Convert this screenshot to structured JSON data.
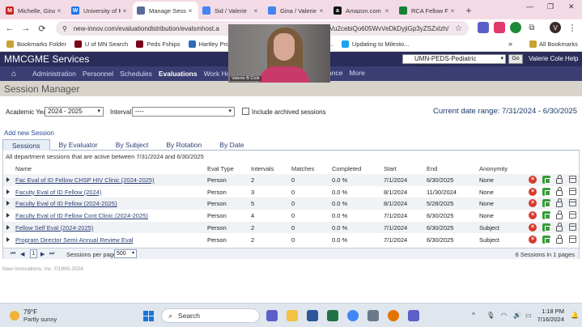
{
  "browser": {
    "tabs": [
      {
        "label": "Michelle, Gina",
        "favicon_color": "#c5221f",
        "favicon_glyph": "M",
        "active": false
      },
      {
        "label": "University of M",
        "favicon_color": "#1a73e8",
        "favicon_glyph": "W",
        "active": false
      },
      {
        "label": "Manage Session",
        "favicon_color": "#5a6a9a",
        "favicon_glyph": "",
        "active": true
      },
      {
        "label": "Sid / Valerie",
        "favicon_color": "#4285f4",
        "favicon_glyph": "",
        "active": false
      },
      {
        "label": "Gina / Valerie",
        "favicon_color": "#4285f4",
        "favicon_glyph": "",
        "active": false
      },
      {
        "label": "Amazon.com",
        "favicon_color": "#111111",
        "favicon_glyph": "a",
        "active": false
      },
      {
        "label": "RCA Fellow F",
        "favicon_color": "#188038",
        "favicon_glyph": "",
        "active": false
      }
    ],
    "tab_close": "×",
    "new_tab": "+",
    "window_controls": {
      "minimize": "—",
      "maximize": "❐",
      "close": "✕",
      "tab_search": "⌄"
    },
    "nav": {
      "back": "←",
      "forward": "→",
      "reload": "⟳"
    },
    "url_left": "new-innov.com/evaluationdistribution/evalsmhost.aspx",
    "url_right": "Vu2cebiQo605WvVeDkDyjiGp3yZSZxlzh/",
    "star": "☆",
    "profile_initial": "V",
    "menu": "⋮",
    "bookmarks": [
      {
        "label": "Bookmarks Folder",
        "icon": "folder-icon",
        "color": "#c9a233"
      },
      {
        "label": "U of MN Search",
        "icon": "gopher-m-icon",
        "color": "#7a0019"
      },
      {
        "label": "Peds Fships",
        "icon": "gopher-m-icon",
        "color": "#7a0019"
      },
      {
        "label": "Hartley Properties I...",
        "icon": "hartley-icon",
        "color": "#2f6db5"
      },
      {
        "label": "port Resou...",
        "icon": "page-icon",
        "color": "#555555"
      },
      {
        "label": "Updating to Milesto...",
        "icon": "twitter-icon",
        "color": "#1da1f2"
      }
    ],
    "bookmarks_more": "»",
    "all_bookmarks": "All Bookmarks"
  },
  "app": {
    "brand": "MMCGME Services",
    "department": "UMN-PEDS-Pediatric Infectious",
    "go_label": "Go",
    "user": "Valerie Cole",
    "help": "Help",
    "nav_left": [
      "Administration",
      "Personnel",
      "Schedules",
      "Evaluations",
      "Work Hours",
      "Lo"
    ],
    "nav_right": [
      "ance",
      "More"
    ],
    "active_nav": "Evaluations",
    "home_icon": "⌂"
  },
  "page": {
    "title": "Session Manager",
    "filters": {
      "academic_year_label": "Academic Year:",
      "academic_year_value": "2024 - 2025",
      "interval_label": "Interval:",
      "interval_value": "----",
      "archived_label": "Include archived sessions",
      "archived_checked": false,
      "caret": "▾"
    },
    "date_range": "Current date range: 7/31/2024 - 6/30/2025",
    "add_new": "Add new Session",
    "subtabs": [
      "Sessions",
      "By Evaluator",
      "By Subject",
      "By Rotation",
      "By Date"
    ],
    "active_subtab": "Sessions",
    "info_text": "All department sessions that are active between 7/31/2024 and 6/30/2025",
    "columns": [
      "Name",
      "Eval Type",
      "Intervals",
      "Matches",
      "Completed",
      "Start",
      "End",
      "Anonymity"
    ],
    "rows": [
      {
        "name": "Fac Eval of ID Fellow CHSP HIV Clinic (2024-2025)",
        "type": "Person",
        "intervals": "2",
        "matches": "0",
        "completed": "0.0 %",
        "start": "7/1/2024",
        "end": "6/30/2025",
        "anonymity": "None"
      },
      {
        "name": "Faculty Eval of ID Fellow (2024)",
        "type": "Person",
        "intervals": "3",
        "matches": "0",
        "completed": "0.0 %",
        "start": "8/1/2024",
        "end": "11/30/2024",
        "anonymity": "None"
      },
      {
        "name": "Faculty Eval of ID Fellow (2024-2025)",
        "type": "Person",
        "intervals": "5",
        "matches": "0",
        "completed": "0.0 %",
        "start": "8/1/2024",
        "end": "5/28/2025",
        "anonymity": "None"
      },
      {
        "name": "Faculty Eval of ID Fellow Cont Clinic (2024-2025)",
        "type": "Person",
        "intervals": "4",
        "matches": "0",
        "completed": "0.0 %",
        "start": "7/1/2024",
        "end": "6/30/2025",
        "anonymity": "None"
      },
      {
        "name": "Fellow Self Eval (2024-2025)",
        "type": "Person",
        "intervals": "2",
        "matches": "0",
        "completed": "0.0 %",
        "start": "7/1/2024",
        "end": "6/30/2025",
        "anonymity": "Subject"
      },
      {
        "name": "Program Director Semi-Annual Review Eval",
        "type": "Person",
        "intervals": "2",
        "matches": "0",
        "completed": "0.0 %",
        "start": "7/1/2024",
        "end": "6/30/2025",
        "anonymity": "Subject"
      }
    ],
    "row_action_glyphs": {
      "delete": "×"
    },
    "pager": {
      "first": "⏮",
      "prev": "◀",
      "current_page": "1",
      "next": "▶",
      "last": "⏭",
      "per_page_label": "Sessions per page",
      "per_page_value": "500",
      "summary": "6 Sessions in 1 pages"
    },
    "copyright": "New Innovations, Inc. ©1995-2024"
  },
  "video": {
    "label": "Valerie B Cole"
  },
  "taskbar": {
    "temp": "79°F",
    "condition": "Partly sunny",
    "search_placeholder": "Search",
    "search_icon": "⌕",
    "time": "1:18 PM",
    "date": "7/16/2024",
    "tray_chevron": "^",
    "apps": [
      {
        "name": "copilot-icon",
        "color": "#5b5fc7"
      },
      {
        "name": "file-explorer-icon",
        "color": "#f4c242"
      },
      {
        "name": "word-icon",
        "color": "#2b579a"
      },
      {
        "name": "excel-icon",
        "color": "#217346"
      },
      {
        "name": "chrome-icon",
        "color": "#4285f4"
      },
      {
        "name": "snip-icon",
        "color": "#6a7a8a"
      },
      {
        "name": "chrome-canary-icon",
        "color": "#e37400"
      },
      {
        "name": "teams-icon",
        "color": "#5b5fc7"
      }
    ]
  }
}
